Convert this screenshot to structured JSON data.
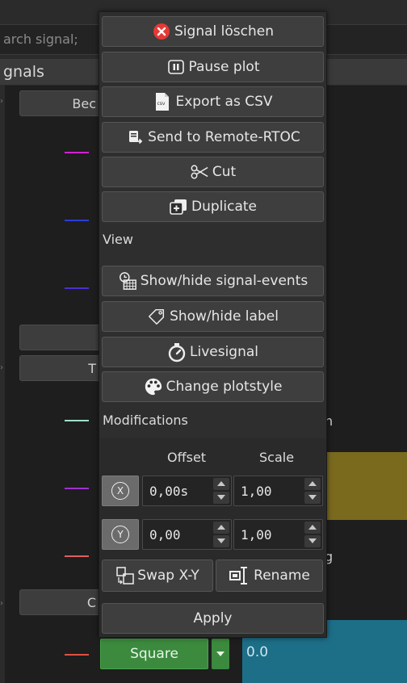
{
  "background": {
    "search_placeholder": "arch signal;",
    "header_title": "gnals",
    "device_buttons": [
      "Bec",
      "",
      "T",
      "C"
    ],
    "signal_button": "Square",
    "value_display": "0.0",
    "clipped_text_1": "n",
    "clipped_text_2": "g"
  },
  "menu": {
    "actions": [
      {
        "label": "Signal löschen",
        "icon": "delete-icon"
      },
      {
        "label": "Pause plot",
        "icon": "pause-icon"
      },
      {
        "label": "Export as CSV",
        "icon": "csv-icon"
      },
      {
        "label": "Send to Remote-RTOC",
        "icon": "remote-send-icon"
      },
      {
        "label": "Cut",
        "icon": "scissors-icon"
      },
      {
        "label": "Duplicate",
        "icon": "duplicate-icon"
      }
    ],
    "view_label": "View",
    "view_actions": [
      {
        "label": "Show/hide signal-events",
        "icon": "events-calendar-icon"
      },
      {
        "label": "Show/hide label",
        "icon": "tag-icon"
      },
      {
        "label": "Livesignal",
        "icon": "stopwatch-icon"
      },
      {
        "label": "Change plotstyle",
        "icon": "palette-icon"
      }
    ],
    "modifications_label": "Modifications",
    "offset_header": "Offset",
    "scale_header": "Scale",
    "x_axis_label": "X",
    "y_axis_label": "Y",
    "x_offset": "0,00s",
    "x_scale": "1,00",
    "y_offset": "0,00",
    "y_scale": "1,00",
    "swap_label": "Swap X-Y",
    "rename_label": "Rename",
    "apply_label": "Apply"
  },
  "colors": {
    "delete_red": "#e53935",
    "line_magenta": "#d61fd6",
    "line_blue": "#2a3fd8",
    "line_indigo": "#4a2fd0",
    "line_mint": "#9fe0c8",
    "line_violet": "#a030d0",
    "line_salmon": "#e06060",
    "line_red": "#e05040"
  }
}
